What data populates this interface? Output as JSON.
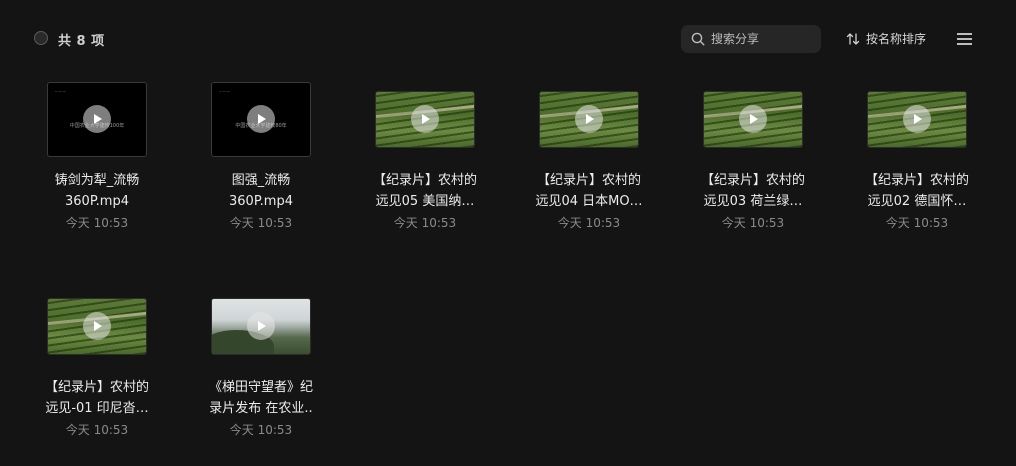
{
  "toolbar": {
    "count_label": "共 8 项",
    "search_placeholder": "搜索分享",
    "sort_label": "按名称排序",
    "icons": {
      "select": "circle-checkbox-icon",
      "search": "search-icon",
      "sort": "sort-arrows-icon",
      "menu": "hamburger-menu-icon"
    }
  },
  "files": [
    {
      "name": "铸剑为犁_流畅\n360P.mp4",
      "time": "今天 10:53",
      "thumb": "dark",
      "caption": "中国农业大学建校100年"
    },
    {
      "name": "图强_流畅\n360P.mp4",
      "time": "今天 10:53",
      "thumb": "dark",
      "caption": "中国农业大学建校80年"
    },
    {
      "name": "【纪录片】农村的\n远见05 美国纳…",
      "time": "今天 10:53",
      "thumb": "field"
    },
    {
      "name": "【纪录片】农村的\n远见04 日本MO…",
      "time": "今天 10:53",
      "thumb": "field"
    },
    {
      "name": "【纪录片】农村的\n远见03 荷兰绿…",
      "time": "今天 10:53",
      "thumb": "field"
    },
    {
      "name": "【纪录片】农村的\n远见02 德国怀…",
      "time": "今天 10:53",
      "thumb": "field"
    },
    {
      "name": "【纪录片】农村的\n远见-01 印尼沓…",
      "time": "今天 10:53",
      "thumb": "field"
    },
    {
      "name": "《梯田守望者》纪\n录片发布 在农业..",
      "time": "今天 10:53",
      "thumb": "mountain"
    }
  ],
  "colors": {
    "background": "#141414",
    "search_bg": "#262626",
    "text_primary": "#ececec",
    "text_secondary": "#8a8a8a"
  }
}
